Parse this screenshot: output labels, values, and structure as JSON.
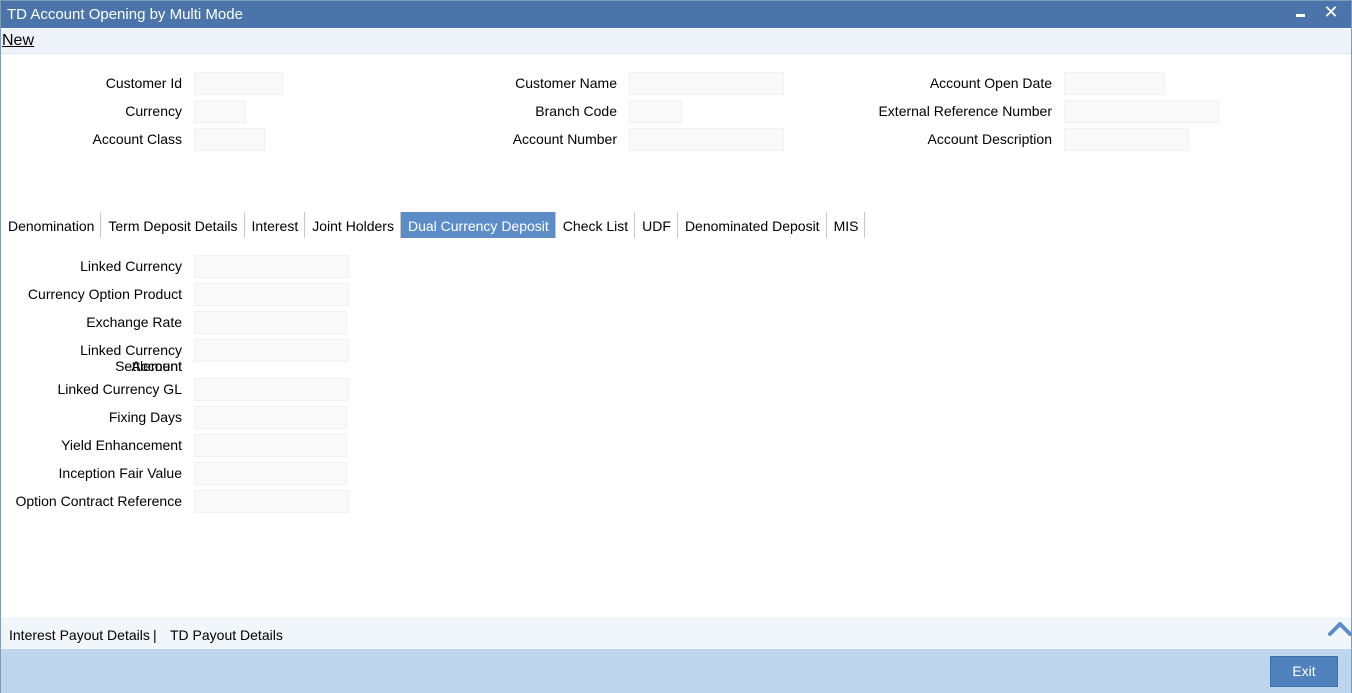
{
  "window": {
    "title": "TD Account Opening by Multi Mode",
    "close_glyph": "✕"
  },
  "menu": {
    "new_label": "New"
  },
  "header_fields": {
    "customer_id": {
      "label": "Customer Id",
      "value": ""
    },
    "currency": {
      "label": "Currency",
      "value": ""
    },
    "account_class": {
      "label": "Account Class",
      "value": ""
    },
    "customer_name": {
      "label": "Customer Name",
      "value": ""
    },
    "branch_code": {
      "label": "Branch Code",
      "value": ""
    },
    "account_number": {
      "label": "Account Number",
      "value": ""
    },
    "account_open_date": {
      "label": "Account Open Date",
      "value": ""
    },
    "external_reference_number": {
      "label": "External Reference Number",
      "value": ""
    },
    "account_description": {
      "label": "Account Description",
      "value": ""
    }
  },
  "tabs": [
    {
      "label": "Denomination",
      "active": false
    },
    {
      "label": "Term Deposit Details",
      "active": false
    },
    {
      "label": "Interest",
      "active": false
    },
    {
      "label": "Joint Holders",
      "active": false
    },
    {
      "label": "Dual Currency Deposit",
      "active": true
    },
    {
      "label": "Check List",
      "active": false
    },
    {
      "label": "UDF",
      "active": false
    },
    {
      "label": "Denominated Deposit",
      "active": false
    },
    {
      "label": "MIS",
      "active": false
    }
  ],
  "dcd_fields": {
    "linked_currency": {
      "label": "Linked Currency",
      "value": ""
    },
    "currency_option_product": {
      "label": "Currency Option Product",
      "value": ""
    },
    "exchange_rate": {
      "label": "Exchange Rate",
      "value": ""
    },
    "linked_currency_settlement_account": {
      "label_line1": "Linked Currency Settlement",
      "label_line2": "Account",
      "value": ""
    },
    "linked_currency_gl": {
      "label": "Linked Currency GL",
      "value": ""
    },
    "fixing_days": {
      "label": "Fixing Days",
      "value": ""
    },
    "yield_enhancement": {
      "label": "Yield Enhancement",
      "value": ""
    },
    "inception_fair_value": {
      "label": "Inception Fair Value",
      "value": ""
    },
    "option_contract_reference": {
      "label": "Option Contract Reference",
      "value": ""
    }
  },
  "footer": {
    "interest_payout_details": "Interest Payout Details",
    "separator": "|",
    "td_payout_details": "TD Payout Details",
    "exit_label": "Exit"
  },
  "colors": {
    "titlebar": "#4a74aa",
    "active_tab": "#5d8dc8",
    "bottombar": "#bdd6ee",
    "exit_button": "#4f81bd"
  },
  "icons": {
    "minimize": "minimize-icon",
    "close": "close-icon",
    "scroll_up": "chevron-up-icon"
  }
}
